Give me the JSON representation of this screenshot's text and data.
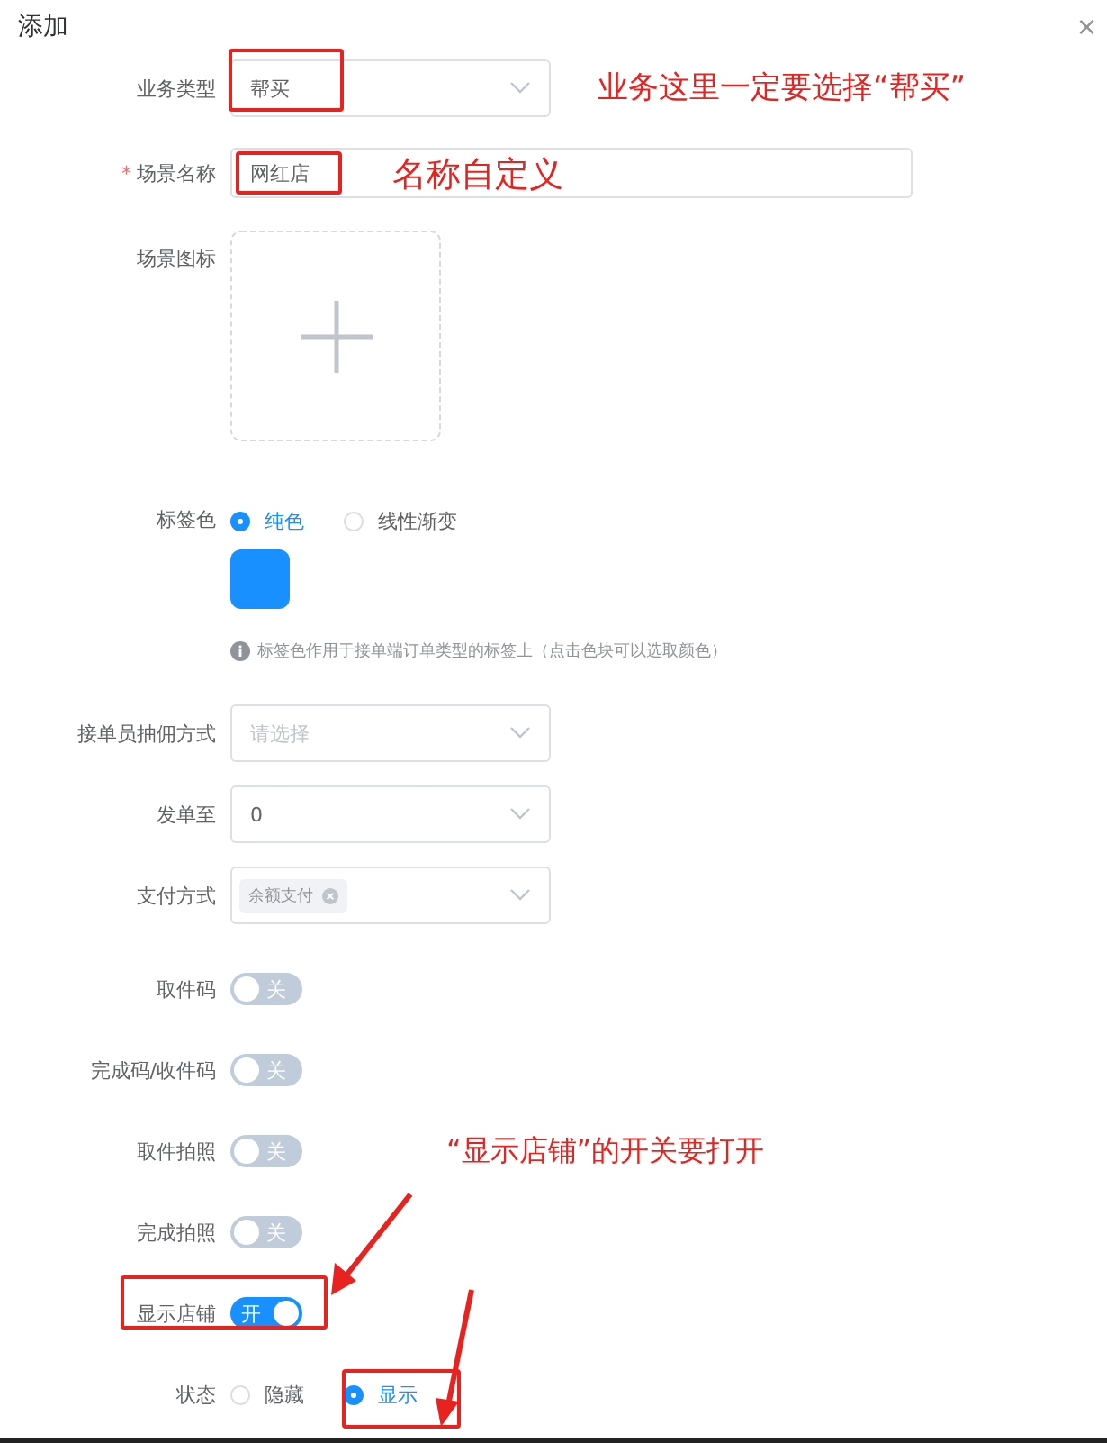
{
  "dialog": {
    "title": "添加",
    "close": "×"
  },
  "fields": [
    {
      "kind": "select",
      "label": "业务类型",
      "value": "帮买"
    },
    {
      "kind": "input",
      "marker": "*",
      "label": "场景名称",
      "value": "网红店"
    },
    {
      "kind": "upload",
      "label": "场景图标"
    },
    {
      "kind": "color",
      "label": "标签色",
      "options": [
        {
          "label": "纯色",
          "selected": true
        },
        {
          "label": "线性渐变",
          "selected": false
        }
      ],
      "color": "#1890ff",
      "hint": "标签色作用于接单端订单类型的标签上（点击色块可以选取颜色）"
    },
    {
      "kind": "select",
      "label": "接单员抽佣方式",
      "placeholder": "请选择"
    },
    {
      "kind": "select",
      "label": "发单至",
      "value": "0"
    },
    {
      "kind": "tags",
      "label": "支付方式",
      "tags": [
        "余额支付"
      ]
    },
    {
      "kind": "switch",
      "label": "取件码",
      "on": false,
      "text": "关"
    },
    {
      "kind": "switch",
      "label": "完成码/收件码",
      "on": false,
      "text": "关"
    },
    {
      "kind": "switch",
      "label": "取件拍照",
      "on": false,
      "text": "关"
    },
    {
      "kind": "switch",
      "label": "完成拍照",
      "on": false,
      "text": "关"
    },
    {
      "kind": "switch",
      "label": "显示店铺",
      "on": true,
      "text": "开"
    },
    {
      "kind": "radio",
      "label": "状态",
      "options": [
        {
          "label": "隐藏",
          "selected": false
        },
        {
          "label": "显示",
          "selected": true
        }
      ]
    }
  ],
  "annotations": [
    "业务这里一定要选择“帮买”",
    "名称自定义",
    "“显示店铺”的开关要打开"
  ]
}
